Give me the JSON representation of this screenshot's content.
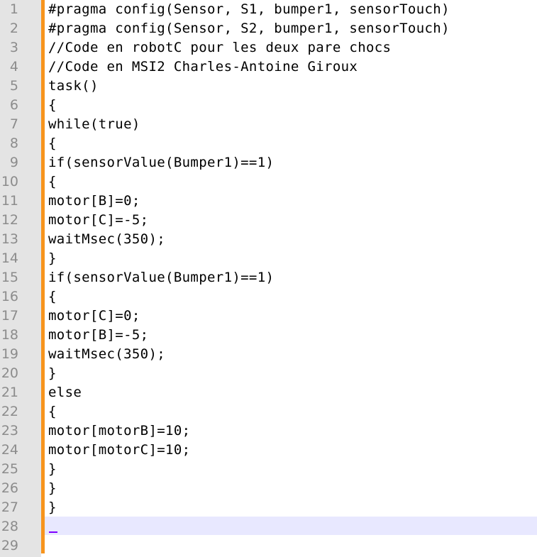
{
  "editor": {
    "colors": {
      "gutter": "#e4e4e4",
      "change_bar": "#f7941d",
      "current_line": "#e8e8ff",
      "caret": "#8000ff",
      "line_number": "#8c8c8c"
    },
    "current_line_number": 28,
    "lines": [
      {
        "num": "1",
        "code": "#pragma config(Sensor, S1, bumper1, sensorTouch)"
      },
      {
        "num": "2",
        "code": "#pragma config(Sensor, S2, bumper1, sensorTouch)"
      },
      {
        "num": "3",
        "code": "//Code en robotC pour les deux pare chocs"
      },
      {
        "num": "4",
        "code": "//Code en MSI2 Charles-Antoine Giroux"
      },
      {
        "num": "5",
        "code": "task()"
      },
      {
        "num": "6",
        "code": "{"
      },
      {
        "num": "7",
        "code": "while(true)"
      },
      {
        "num": "8",
        "code": "{"
      },
      {
        "num": "9",
        "code": "if(sensorValue(Bumper1)==1)"
      },
      {
        "num": "10",
        "code": "{"
      },
      {
        "num": "11",
        "code": "motor[B]=0;"
      },
      {
        "num": "12",
        "code": "motor[C]=-5;"
      },
      {
        "num": "13",
        "code": "waitMsec(350);"
      },
      {
        "num": "14",
        "code": "}"
      },
      {
        "num": "15",
        "code": "if(sensorValue(Bumper1)==1)"
      },
      {
        "num": "16",
        "code": "{"
      },
      {
        "num": "17",
        "code": "motor[C]=0;"
      },
      {
        "num": "18",
        "code": "motor[B]=-5;"
      },
      {
        "num": "19",
        "code": "waitMsec(350);"
      },
      {
        "num": "20",
        "code": "}"
      },
      {
        "num": "21",
        "code": "else"
      },
      {
        "num": "22",
        "code": "{"
      },
      {
        "num": "23",
        "code": "motor[motorB]=10;"
      },
      {
        "num": "24",
        "code": "motor[motorC]=10;"
      },
      {
        "num": "25",
        "code": "}"
      },
      {
        "num": "26",
        "code": "}"
      },
      {
        "num": "27",
        "code": "}"
      },
      {
        "num": "28",
        "code": ""
      },
      {
        "num": "29",
        "code": ""
      }
    ]
  }
}
